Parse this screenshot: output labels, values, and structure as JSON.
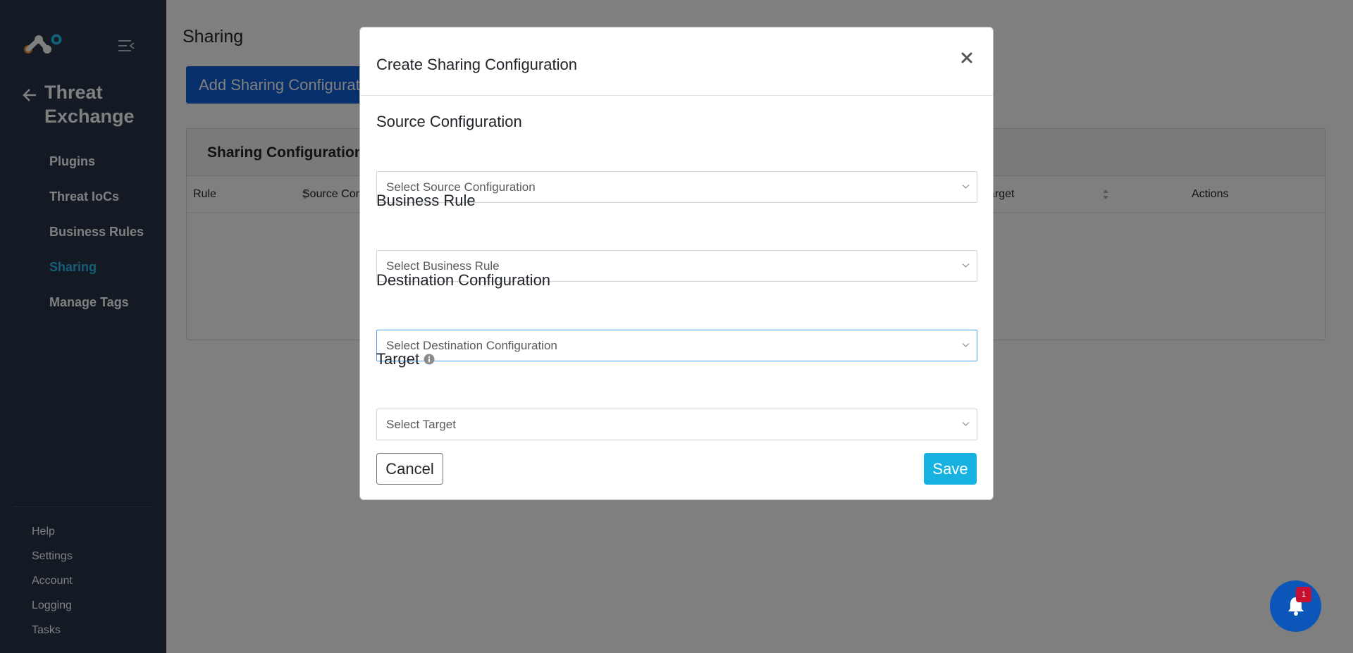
{
  "sidebar": {
    "module_title": "Threat Exchange",
    "nav_items": [
      {
        "label": "Plugins"
      },
      {
        "label": "Threat IoCs"
      },
      {
        "label": "Business Rules"
      },
      {
        "label": "Sharing",
        "active": true
      },
      {
        "label": "Manage Tags"
      }
    ],
    "bottom_items": [
      {
        "label": "Help"
      },
      {
        "label": "Settings"
      },
      {
        "label": "Account"
      },
      {
        "label": "Logging"
      },
      {
        "label": "Tasks"
      }
    ]
  },
  "main": {
    "page_title": "Sharing",
    "add_button": "Add Sharing Configuration",
    "card_title": "Sharing Configurations",
    "table_headers": [
      "Rule",
      "Source Configuration",
      "Target",
      "Actions"
    ]
  },
  "modal": {
    "title": "Create Sharing Configuration",
    "fields": {
      "source": {
        "label": "Source Configuration",
        "placeholder": "Select Source Configuration"
      },
      "business_rule": {
        "label": "Business Rule",
        "placeholder": "Select Business Rule"
      },
      "destination": {
        "label": "Destination Configuration",
        "placeholder": "Select Destination Configuration"
      },
      "target": {
        "label": "Target",
        "placeholder": "Select Target"
      }
    },
    "cancel_label": "Cancel",
    "save_label": "Save"
  },
  "notifications": {
    "count": "1"
  },
  "colors": {
    "sidebar_bg": "#263548",
    "active_nav": "#2ebcf2",
    "primary_button": "#0f5fd6",
    "save_button": "#17b2e0",
    "badge": "#c8102e"
  },
  "icons": [
    "logo-icon",
    "collapse-menu-icon",
    "back-arrow-icon",
    "close-icon",
    "info-icon",
    "chevron-down-icon",
    "sort-icon",
    "bell-icon"
  ]
}
